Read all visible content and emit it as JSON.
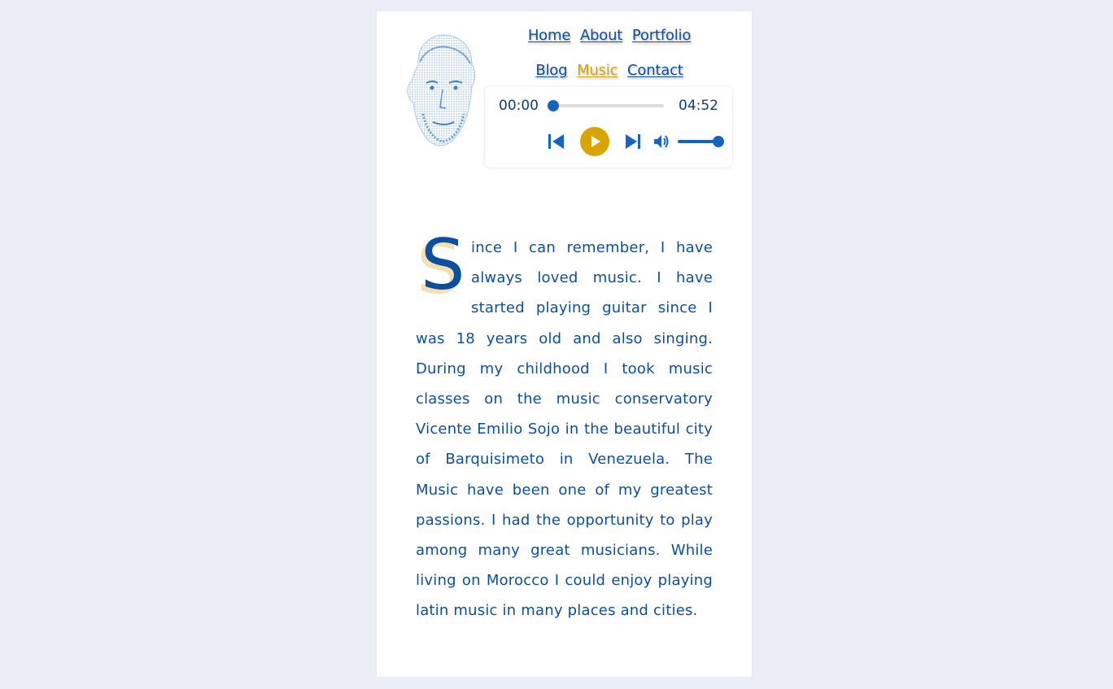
{
  "nav": {
    "items": [
      {
        "label": "Home",
        "active": false
      },
      {
        "label": "About",
        "active": false
      },
      {
        "label": "Portfolio",
        "active": false
      },
      {
        "label": "Blog",
        "active": false
      },
      {
        "label": "Music",
        "active": true
      },
      {
        "label": "Contact",
        "active": false
      }
    ]
  },
  "player": {
    "current_time": "00:00",
    "duration": "04:52",
    "progress": 0.0,
    "volume": 1.0,
    "controls": [
      "previous-icon",
      "play-icon",
      "next-icon",
      "volume-icon"
    ]
  },
  "article": {
    "dropcap": "S",
    "text": "ince I can remember, I have always loved music. I have started playing guitar since I was 18 years old and also singing. During my childhood I took music classes on the music conservatory Vicente Emilio Sojo in the beautiful city of Barquisimeto in Venezuela. The Music have been one of my greatest passions. I had the opportunity to play among many great musicians. While living on Morocco I could enjoy playing latin music in many places and cities."
  },
  "colors": {
    "background": "#eaeff7",
    "card": "#ffffff",
    "primary": "#0b4f9e",
    "accent": "#d9a400",
    "control_blue": "#1565c0",
    "dropcap_shadow": "#f3dfb0"
  }
}
